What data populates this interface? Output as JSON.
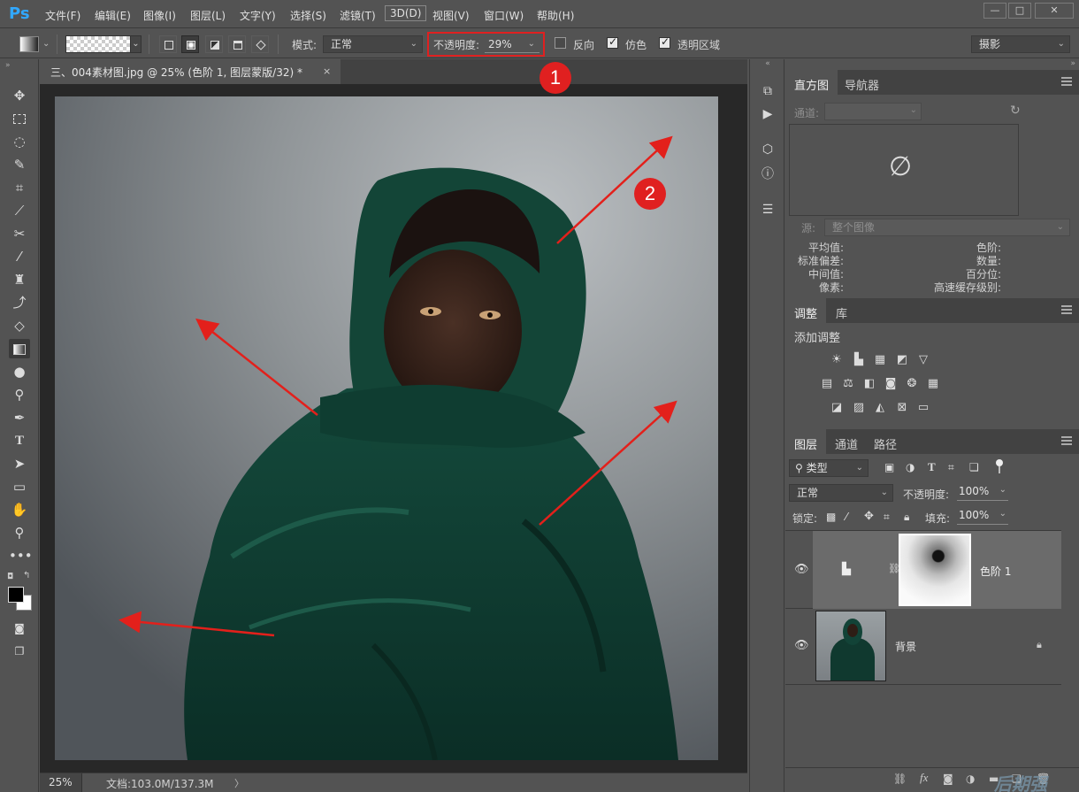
{
  "app": {
    "logo": "Ps"
  },
  "menu": [
    "文件(F)",
    "编辑(E)",
    "图像(I)",
    "图层(L)",
    "文字(Y)",
    "选择(S)",
    "滤镜(T)",
    "3D(D)",
    "视图(V)",
    "窗口(W)",
    "帮助(H)"
  ],
  "window_controls": {
    "minimize": "—",
    "restore": "□",
    "close": "✕"
  },
  "options": {
    "mode_label": "模式:",
    "mode_value": "正常",
    "opacity_label": "不透明度:",
    "opacity_value": "29%",
    "reverse_label": "反向",
    "reverse_checked": false,
    "dither_label": "仿色",
    "dither_checked": true,
    "transparency_label": "透明区域",
    "transparency_checked": true,
    "workspace_value": "摄影"
  },
  "document": {
    "tab_title": "三、004素材图.jpg @ 25% (色阶 1, 图层蒙版/32) *",
    "tab_close": "×",
    "zoom": "25%",
    "doc_info": "文档:103.0M/137.3M",
    "status_arrow": "〉"
  },
  "annotations": {
    "marker1": "1",
    "marker2": "2",
    "colors": {
      "marker": "#e02020",
      "arrow": "#e3201b",
      "highlight_box": "#e02020"
    }
  },
  "histogram": {
    "tabs": [
      "直方图",
      "导航器"
    ],
    "channel_label": "通道:",
    "source_label": "源:",
    "source_value": "整个图像",
    "empty_symbol": "∅",
    "stats_left": [
      {
        "label": "平均值:"
      },
      {
        "label": "标准偏差:"
      },
      {
        "label": "中间值:"
      },
      {
        "label": "像素:"
      }
    ],
    "stats_right": [
      {
        "label": "色阶:"
      },
      {
        "label": "数量:"
      },
      {
        "label": "百分位:"
      },
      {
        "label": "高速缓存级别:"
      }
    ]
  },
  "adjustments": {
    "tabs": [
      "调整",
      "库"
    ],
    "add_label": "添加调整",
    "row1": [
      "brightness-contrast-icon",
      "levels-icon",
      "curves-icon",
      "exposure-icon",
      "vibrance-icon"
    ],
    "row2": [
      "hue-saturation-icon",
      "color-balance-icon",
      "black-white-icon",
      "photo-filter-icon",
      "channel-mixer-icon",
      "color-lookup-icon"
    ],
    "row3": [
      "invert-icon",
      "posterize-icon",
      "threshold-icon",
      "selective-color-icon",
      "gradient-map-icon"
    ]
  },
  "layers": {
    "tabs": [
      "图层",
      "通道",
      "路径"
    ],
    "filter_label": "类型",
    "blend_value": "正常",
    "opacity_label": "不透明度:",
    "opacity_value": "100%",
    "lock_label": "锁定:",
    "fill_label": "填充:",
    "fill_value": "100%",
    "items": [
      {
        "name": "色阶 1",
        "selected": true
      },
      {
        "name": "背景",
        "selected": false
      }
    ]
  },
  "watermark": "后期强"
}
